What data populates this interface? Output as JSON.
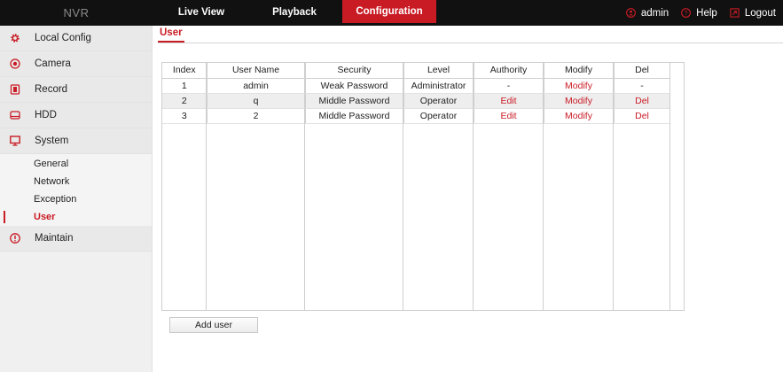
{
  "brand": "NVR",
  "nav": {
    "live_view": "Live View",
    "playback": "Playback",
    "configuration": "Configuration"
  },
  "top_right": {
    "user": "admin",
    "help": "Help",
    "logout": "Logout"
  },
  "sidebar": {
    "items": [
      {
        "label": "Local Config",
        "icon": "gear-icon"
      },
      {
        "label": "Camera",
        "icon": "camera-icon"
      },
      {
        "label": "Record",
        "icon": "record-icon"
      },
      {
        "label": "HDD",
        "icon": "hdd-icon"
      },
      {
        "label": "System",
        "icon": "monitor-icon"
      }
    ],
    "system_sub": [
      "General",
      "Network",
      "Exception",
      "User"
    ],
    "maintain": {
      "label": "Maintain",
      "icon": "info-icon"
    }
  },
  "tab": "User",
  "table": {
    "headers": [
      "Index",
      "User Name",
      "Security",
      "Level",
      "Authority",
      "Modify",
      "Del"
    ],
    "rows": [
      {
        "index": "1",
        "name": "admin",
        "security": "Weak Password",
        "level": "Administrator",
        "authority": "-",
        "modify": "Modify",
        "del": "-"
      },
      {
        "index": "2",
        "name": "q",
        "security": "Middle Password",
        "level": "Operator",
        "authority": "Edit",
        "modify": "Modify",
        "del": "Del"
      },
      {
        "index": "3",
        "name": "2",
        "security": "Middle Password",
        "level": "Operator",
        "authority": "Edit",
        "modify": "Modify",
        "del": "Del"
      }
    ]
  },
  "add_user_label": "Add user",
  "colors": {
    "accent": "#c91b24",
    "topbar": "#111111",
    "sidebar": "#f0f0f0"
  }
}
